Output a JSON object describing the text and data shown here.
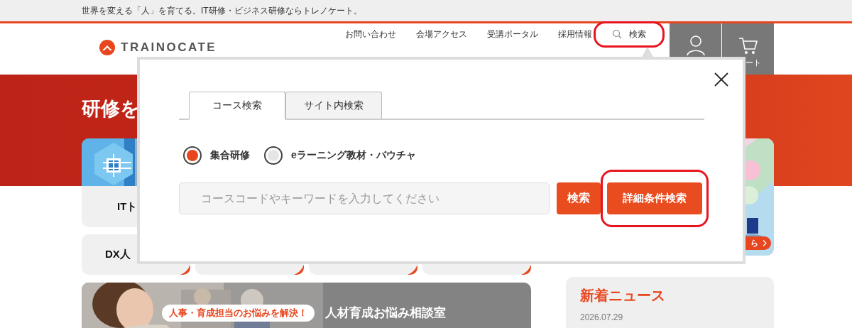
{
  "tagline": "世界を変える「人」を育てる。IT研修・ビジネス研修ならトレノケート。",
  "logo": {
    "text": "TRAINOCATE"
  },
  "top_links": [
    {
      "label": "お問い合わせ",
      "kind": "link",
      "highlighted": false
    },
    {
      "label": "会場アクセス",
      "kind": "link",
      "highlighted": false
    },
    {
      "label": "受講ポータル",
      "kind": "link",
      "highlighted": false
    },
    {
      "label": "採用情報",
      "kind": "link",
      "highlighted": false
    },
    {
      "label": "検索",
      "kind": "search",
      "highlighted": true
    }
  ],
  "header_buttons": [
    {
      "kind": "user"
    },
    {
      "kind": "cart",
      "label": "ート"
    }
  ],
  "hero": {
    "title": "研修を"
  },
  "cards": [
    {
      "label": "ITト",
      "kind": "picture"
    }
  ],
  "cards_row2": [
    {
      "kind": "titled",
      "label": "DX人"
    },
    {
      "kind": "blank"
    },
    {
      "kind": "blank"
    },
    {
      "kind": "blank"
    }
  ],
  "banner": {
    "kind": "picture",
    "badge": "人事・育成担当のお悩みを解決！",
    "title": "人材育成お悩み相談室"
  },
  "side_banner": {
    "kind": "picture",
    "button": "ら"
  },
  "news": {
    "title": "新着ニュース",
    "date": "2026.07.29"
  },
  "modal": {
    "tabs": [
      {
        "label": "コース検索",
        "selected": true
      },
      {
        "label": "サイト内検索",
        "selected": false
      }
    ],
    "radios": [
      {
        "label": "集合研修",
        "selected": true
      },
      {
        "label": "eラーニング教材・バウチャ",
        "selected": false
      }
    ],
    "search": {
      "placeholder": "コースコードやキーワードを入力してください"
    },
    "buttons": [
      {
        "label": "検索",
        "highlighted": false
      },
      {
        "label": "詳細条件検索",
        "highlighted": true
      }
    ]
  }
}
